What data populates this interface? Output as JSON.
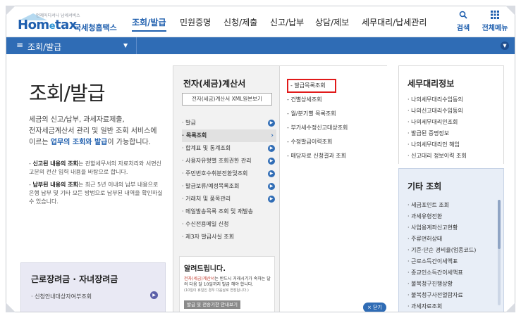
{
  "logo": {
    "tagline": "언제어디서나 납세서비스",
    "brand_hom": "Hom",
    "brand_e": "e",
    "brand_tax": "tax",
    "sub": "국세청홈택스"
  },
  "nav": {
    "items": [
      "조회/발급",
      "민원증명",
      "신청/제출",
      "신고/납부",
      "상담/제보",
      "세무대리/납세관리"
    ],
    "active": "조회/발급"
  },
  "tools": {
    "search": "검색",
    "all_menu": "전체메뉴"
  },
  "bar": {
    "title": "조회/발급"
  },
  "intro": {
    "title": "조회/발급",
    "desc_1": "세금의 신고/납부, 과세자료제출,",
    "desc_2": "전자세금계산서 관리 및 일반 조회 서비스에",
    "desc_3a": "이르는 ",
    "desc_3b": "업무의 조회와 발급",
    "desc_3c": "이 가능합니다.",
    "note1_b": "신고된 내용의 조회",
    "note1_t": "는 관할세무서의 자료처리와 서면신고분의 전산 입력 내용을 바탕으로 합니다.",
    "note2_b": "납부된 내용의 조회",
    "note2_t": "는 최근 5년 이내의 납부 내용으로 은행 납부 및 기타 모든 방법으로 납부된 내역을 확인하실 수 있습니다."
  },
  "left_box": {
    "title": "근로장려금 · 자녀장려금",
    "item": "신청안내대상자여부조회"
  },
  "panel_a": {
    "title": "전자(세금)계산서",
    "xml_button": "전자(세금)계산서 XML원본보기",
    "items": [
      {
        "label": "발급",
        "arrow": true,
        "selected": false
      },
      {
        "label": "목록조회",
        "arrow": false,
        "selected": true
      },
      {
        "label": "합계표 및 통계조회",
        "arrow": true,
        "selected": false
      },
      {
        "label": "사용자유형별 조회권한 관리",
        "arrow": true,
        "selected": false
      },
      {
        "label": "주민번호수취분전환및조회",
        "arrow": true,
        "selected": false
      },
      {
        "label": "발급보류/예정목록조회",
        "arrow": true,
        "selected": false
      },
      {
        "label": "거래처 및 품목관리",
        "arrow": true,
        "selected": false
      },
      {
        "label": "메일발송목록 조회 및 재발송",
        "arrow": false,
        "selected": false
      },
      {
        "label": "수신전용메일 신청",
        "arrow": false,
        "selected": false
      },
      {
        "label": "제3자 발급사실 조회",
        "arrow": false,
        "selected": false
      }
    ]
  },
  "notice": {
    "title": "알려드립니다.",
    "text_red": "전자(세금)계산서",
    "text_1": "는 반드시 거래시기가 속하는 달의 다음 달 10일까지 발급 해야 합니다.",
    "text_small": "(10일이 휴일인 경우 다음날로 연장됩니다.)",
    "button": "발급 및 전송기한 안내보기"
  },
  "panel_b": {
    "items": [
      "발급목록조회",
      "건별상세조회",
      "월/분기별 목록조회",
      "부가세수정신고대상조회",
      "수정발급이력조회",
      "매당자료 신청결과 조회"
    ],
    "close": "× 닫기"
  },
  "right_top": {
    "title": "세무대리정보",
    "items": [
      "나의세무대리수임동의",
      "나의신고대리수임동의",
      "나의세무대리인조회",
      "발급된 증명정보",
      "나의세무대리인 해임",
      "신고대리 정보이력 조회"
    ]
  },
  "right_bottom": {
    "title": "기타 조회",
    "items": [
      "세금포인트 조회",
      "과세유형전환",
      "사업용계좌신고현황",
      "주류면허상태",
      "기준·단순 경비율(업종코드)",
      "근로소득간이세액표",
      "종교인소득간이세액표",
      "불복청구진행상황",
      "불복청구사전열람자료",
      "과세자료조회"
    ]
  }
}
